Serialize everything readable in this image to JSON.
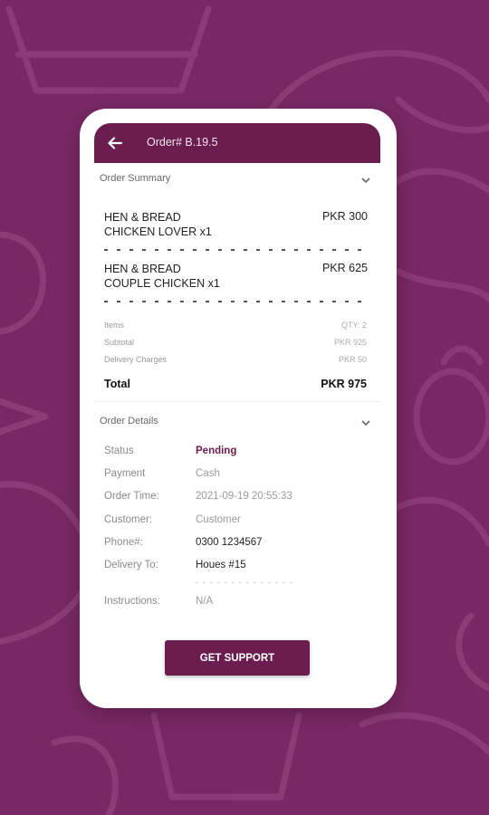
{
  "header": {
    "title": "Order# B.19.5",
    "back_icon": "arrow-left-icon"
  },
  "order_summary": {
    "title": "Order Summary",
    "items": [
      {
        "name_line1": "HEN & BREAD",
        "name_line2": "CHICKEN LOVER x1",
        "price": "PKR 300"
      },
      {
        "name_line1": "HEN & BREAD",
        "name_line2": "COUPLE CHICKEN x1",
        "price": "PKR 625"
      }
    ],
    "items_label": "Items",
    "items_value": "QTY: 2",
    "subtotal_label": "Subtotal",
    "subtotal_value": "PKR 925",
    "delivery_label": "Delivery Charges",
    "delivery_value": "PKR 50",
    "total_label": "Total",
    "total_value": "PKR 975"
  },
  "order_details": {
    "title": "Order Details",
    "status_label": "Status",
    "status_value": "Pending",
    "payment_label": "Payment",
    "payment_value": "Cash",
    "time_label": "Order Time:",
    "time_value": "2021-09-19 20:55:33",
    "customer_label": "Customer:",
    "customer_value": "Customer",
    "phone_label": "Phone#:",
    "phone_value": "0300 1234567",
    "delivery_label": "Delivery To:",
    "delivery_value": "Houes #15",
    "instructions_label": "Instructions:",
    "instructions_value": "N/A"
  },
  "support_button": {
    "label": "GET SUPPORT"
  },
  "colors": {
    "background": "#7a2864",
    "primary": "#6b1d4f",
    "card": "#ffffff"
  }
}
